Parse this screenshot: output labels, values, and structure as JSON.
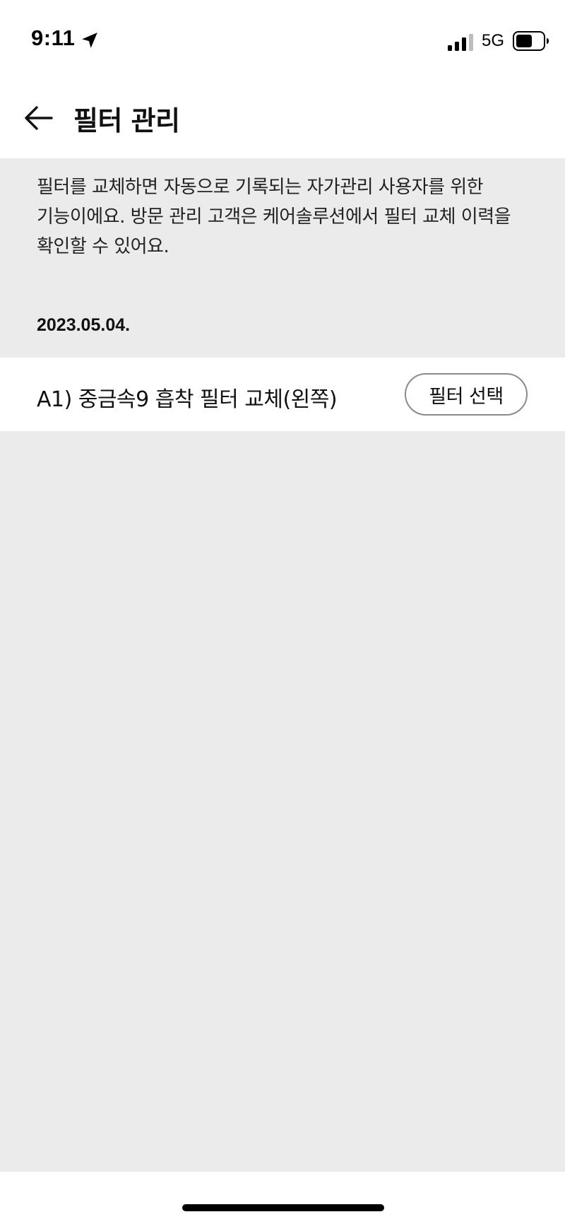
{
  "status_bar": {
    "time": "9:11",
    "network": "5G",
    "icons": [
      "location-arrow-icon",
      "signal-icon",
      "battery-icon"
    ]
  },
  "header": {
    "title": "필터 관리",
    "back_icon": "back-arrow-icon"
  },
  "info": {
    "description": "필터를 교체하면 자동으로 기록되는 자가관리 사용자를 위한 기능이에요. 방문 관리 고객은 케어솔루션에서 필터 교체 이력을 확인할 수 있어요.",
    "date": "2023.05.04."
  },
  "filters": [
    {
      "name": "A1) 중금속9 흡착 필터 교체(왼쪽)",
      "button_label": "필터 선택"
    }
  ],
  "colors": {
    "background": "#ebebeb",
    "surface": "#ffffff",
    "text": "#111111",
    "button_border": "#8a8a8a"
  }
}
